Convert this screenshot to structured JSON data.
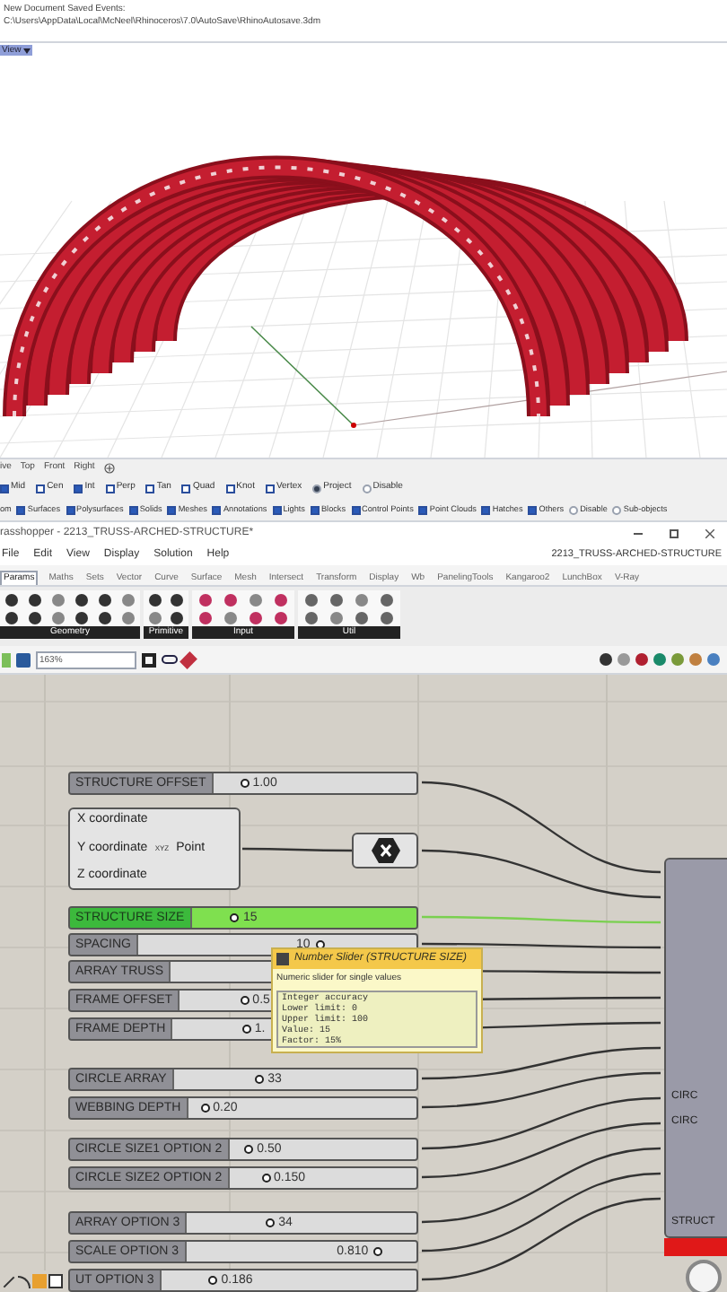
{
  "command_history": [
    "New Document Saved Events:",
    "C:\\Users\\AppData\\Local\\McNeel\\Rhinoceros\\7.0\\AutoSave\\RhinoAutosave.3dm"
  ],
  "view_menu": {
    "label": "View"
  },
  "viewport_tabs": [
    "ive",
    "Top",
    "Front",
    "Right"
  ],
  "osnaps": [
    {
      "label": "Mid",
      "kind": "check",
      "checked": true
    },
    {
      "label": "Cen",
      "kind": "check",
      "checked": false
    },
    {
      "label": "Int",
      "kind": "check",
      "checked": true
    },
    {
      "label": "Perp",
      "kind": "check",
      "checked": false
    },
    {
      "label": "Tan",
      "kind": "check",
      "checked": false
    },
    {
      "label": "Quad",
      "kind": "check",
      "checked": false
    },
    {
      "label": "Knot",
      "kind": "check",
      "checked": false
    },
    {
      "label": "Vertex",
      "kind": "check",
      "checked": false
    },
    {
      "label": "Project",
      "kind": "radio",
      "checked": true
    },
    {
      "label": "Disable",
      "kind": "radio",
      "checked": false
    }
  ],
  "selection_filter": [
    {
      "label": "om",
      "kind": "text"
    },
    {
      "label": "Surfaces",
      "kind": "check",
      "checked": true
    },
    {
      "label": "Polysurfaces",
      "kind": "check",
      "checked": true
    },
    {
      "label": "Solids",
      "kind": "check",
      "checked": true
    },
    {
      "label": "Meshes",
      "kind": "check",
      "checked": true
    },
    {
      "label": "Annotations",
      "kind": "check",
      "checked": true
    },
    {
      "label": "Lights",
      "kind": "check",
      "checked": true
    },
    {
      "label": "Blocks",
      "kind": "check",
      "checked": true
    },
    {
      "label": "Control Points",
      "kind": "check",
      "checked": true
    },
    {
      "label": "Point Clouds",
      "kind": "check",
      "checked": true
    },
    {
      "label": "Hatches",
      "kind": "check",
      "checked": true
    },
    {
      "label": "Others",
      "kind": "check",
      "checked": true
    },
    {
      "label": "Disable",
      "kind": "radio",
      "checked": false
    },
    {
      "label": "Sub-objects",
      "kind": "radio",
      "checked": false
    }
  ],
  "grasshopper": {
    "title": "rasshopper - 2213_TRUSS-ARCHED-STRUCTURE*",
    "menu": [
      "File",
      "Edit",
      "View",
      "Display",
      "Solution",
      "Help"
    ],
    "document_name": "2213_TRUSS-ARCHED-STRUCTURE",
    "tabs": [
      {
        "label": "Params",
        "selected": true
      },
      {
        "label": "Maths",
        "selected": false
      },
      {
        "label": "Sets",
        "selected": false
      },
      {
        "label": "Vector",
        "selected": false
      },
      {
        "label": "Curve",
        "selected": false
      },
      {
        "label": "Surface",
        "selected": false
      },
      {
        "label": "Mesh",
        "selected": false
      },
      {
        "label": "Intersect",
        "selected": false
      },
      {
        "label": "Transform",
        "selected": false
      },
      {
        "label": "Display",
        "selected": false
      },
      {
        "label": "Wb",
        "selected": false
      },
      {
        "label": "PanelingTools",
        "selected": false
      },
      {
        "label": "Kangaroo2",
        "selected": false
      },
      {
        "label": "LunchBox",
        "selected": false
      },
      {
        "label": "V-Ray",
        "selected": false
      }
    ],
    "ribbon_groups": [
      "Geometry",
      "Primitive",
      "Input",
      "Util"
    ],
    "zoom": "163%"
  },
  "canvas": {
    "sliders": [
      {
        "name": "STRUCTURE OFFSET",
        "value": "1.00",
        "level": 0.15,
        "selected": false
      },
      {
        "name": "STRUCTURE SIZE",
        "value": "15",
        "level": 0.19,
        "selected": true
      },
      {
        "name": "SPACING",
        "value": "10",
        "level": 0.65,
        "selected": false
      },
      {
        "name": "ARRAY TRUSS",
        "selected": false
      },
      {
        "name": "FRAME OFFSET",
        "value": "0.5",
        "level": 0.27,
        "selected": false
      },
      {
        "name": "FRAME DEPTH",
        "value": "1.",
        "level": 0.3,
        "selected": false
      },
      {
        "name": "CIRCLE ARRAY",
        "value": "33",
        "level": 0.35,
        "selected": false
      },
      {
        "name": "WEBBING DEPTH",
        "value": "0.20",
        "level": 0.07,
        "selected": false
      },
      {
        "name": "CIRCLE SIZE1 OPTION 2",
        "value": "0.50",
        "level": 0.1,
        "selected": false
      },
      {
        "name": "CIRCLE SIZE2 OPTION 2",
        "value": "0.150",
        "level": 0.19,
        "selected": false
      },
      {
        "name": "ARRAY OPTION 3",
        "value": "34",
        "level": 0.36,
        "selected": false
      },
      {
        "name": "SCALE OPTION 3",
        "value": "0.810",
        "level": 0.83,
        "selected": false
      },
      {
        "name": "UT OPTION 3",
        "value": "0.186",
        "level": 0.2,
        "selected": false
      }
    ],
    "point_component": {
      "inputs": [
        "X coordinate",
        "Y coordinate",
        "Z coordinate"
      ],
      "icon_label": "XYZ",
      "output": "Point"
    },
    "tooltip": {
      "title": "Number Slider (STRUCTURE SIZE)",
      "description": "Numeric slider for single values",
      "details": [
        "Integer accuracy",
        "Lower limit: 0",
        "Upper limit: 100",
        "Value: 15",
        "Factor: 15%"
      ]
    },
    "component_labels": [
      "CIRC",
      "CIRC",
      "STRUCT"
    ]
  }
}
